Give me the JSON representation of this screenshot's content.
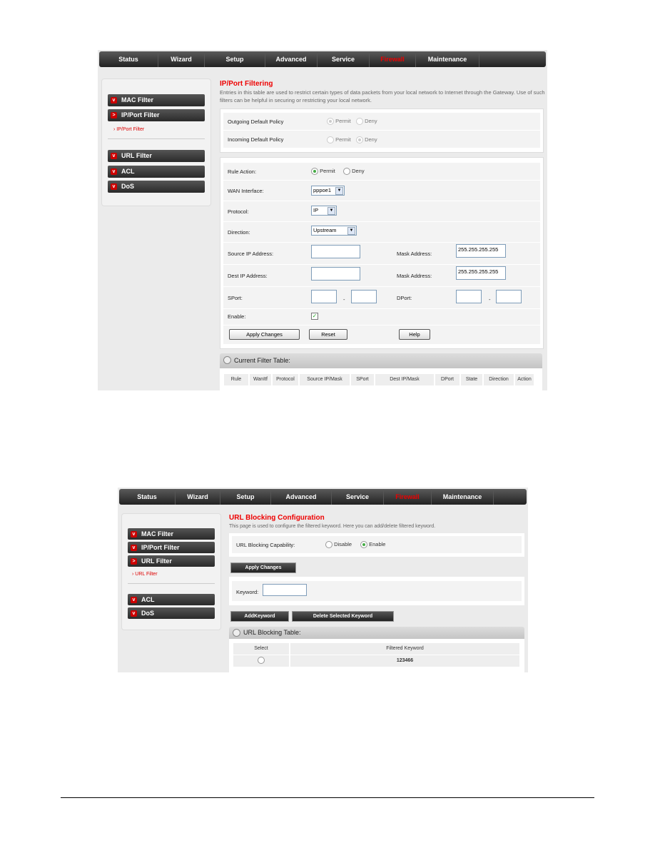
{
  "nav": [
    "Status",
    "Wizard",
    "Setup",
    "Advanced",
    "Service",
    "Firewall",
    "Maintenance"
  ],
  "nav_active": "Firewall",
  "colors": {
    "accent": "#e00000",
    "nav_bg": "#2a2a2a"
  },
  "shot1": {
    "sidebar": {
      "items": [
        "MAC Filter",
        "IP/Port Filter",
        "URL Filter",
        "ACL",
        "DoS"
      ],
      "sub": "IP/Port Filter"
    },
    "title": "IP/Port Filtering",
    "desc": "Entries in this table are used to restrict certain types of data packets from your local network to Internet through the Gateway. Use of such filters can be helpful in securing or restricting your local network.",
    "policy": {
      "outgoing": "Outgoing Default Policy",
      "incoming": "Incoming Default Policy",
      "permit": "Permit",
      "deny": "Deny",
      "outgoing_value": "Permit",
      "incoming_value": "Deny"
    },
    "form": {
      "rule_action": "Rule Action:",
      "permit": "Permit",
      "deny": "Deny",
      "rule_value": "Permit",
      "wan": "WAN Interface:",
      "wan_value": "pppoe1",
      "protocol": "Protocol:",
      "protocol_value": "IP",
      "direction": "Direction:",
      "direction_value": "Upstream",
      "src_ip": "Source IP Address:",
      "dst_ip": "Dest IP Address:",
      "mask": "Mask Address:",
      "mask_value": "255.255.255.255",
      "sport": "SPort:",
      "dport": "DPort:",
      "dash": "-",
      "enable": "Enable:",
      "enable_checked": true,
      "apply": "Apply Changes",
      "reset": "Reset",
      "help": "Help"
    },
    "table": {
      "title": "Current Filter Table:",
      "columns": [
        "Rule",
        "WanItf",
        "Protocol",
        "Source IP/Mask",
        "SPort",
        "Dest IP/Mask",
        "DPort",
        "State",
        "Direction",
        "Action"
      ]
    }
  },
  "shot2": {
    "sidebar": {
      "items": [
        "MAC Filter",
        "IP/Port Filter",
        "URL Filter",
        "ACL",
        "DoS"
      ],
      "sub": "URL Filter"
    },
    "title": "URL Blocking Configuration",
    "desc": "This page is used to configure the filtered keyword. Here you can add/delete filtered keyword.",
    "capability": "URL Blocking Capability:",
    "disable": "Disable",
    "enable": "Enable",
    "capability_value": "Enable",
    "apply": "Apply Changes",
    "keyword": "Keyword:",
    "add": "AddKeyword",
    "delete": "Delete Selected Keyword",
    "table": {
      "title": "URL Blocking Table:",
      "columns": [
        "Select",
        "Filtered Keyword"
      ],
      "rows": [
        {
          "keyword": "123466"
        }
      ]
    }
  }
}
